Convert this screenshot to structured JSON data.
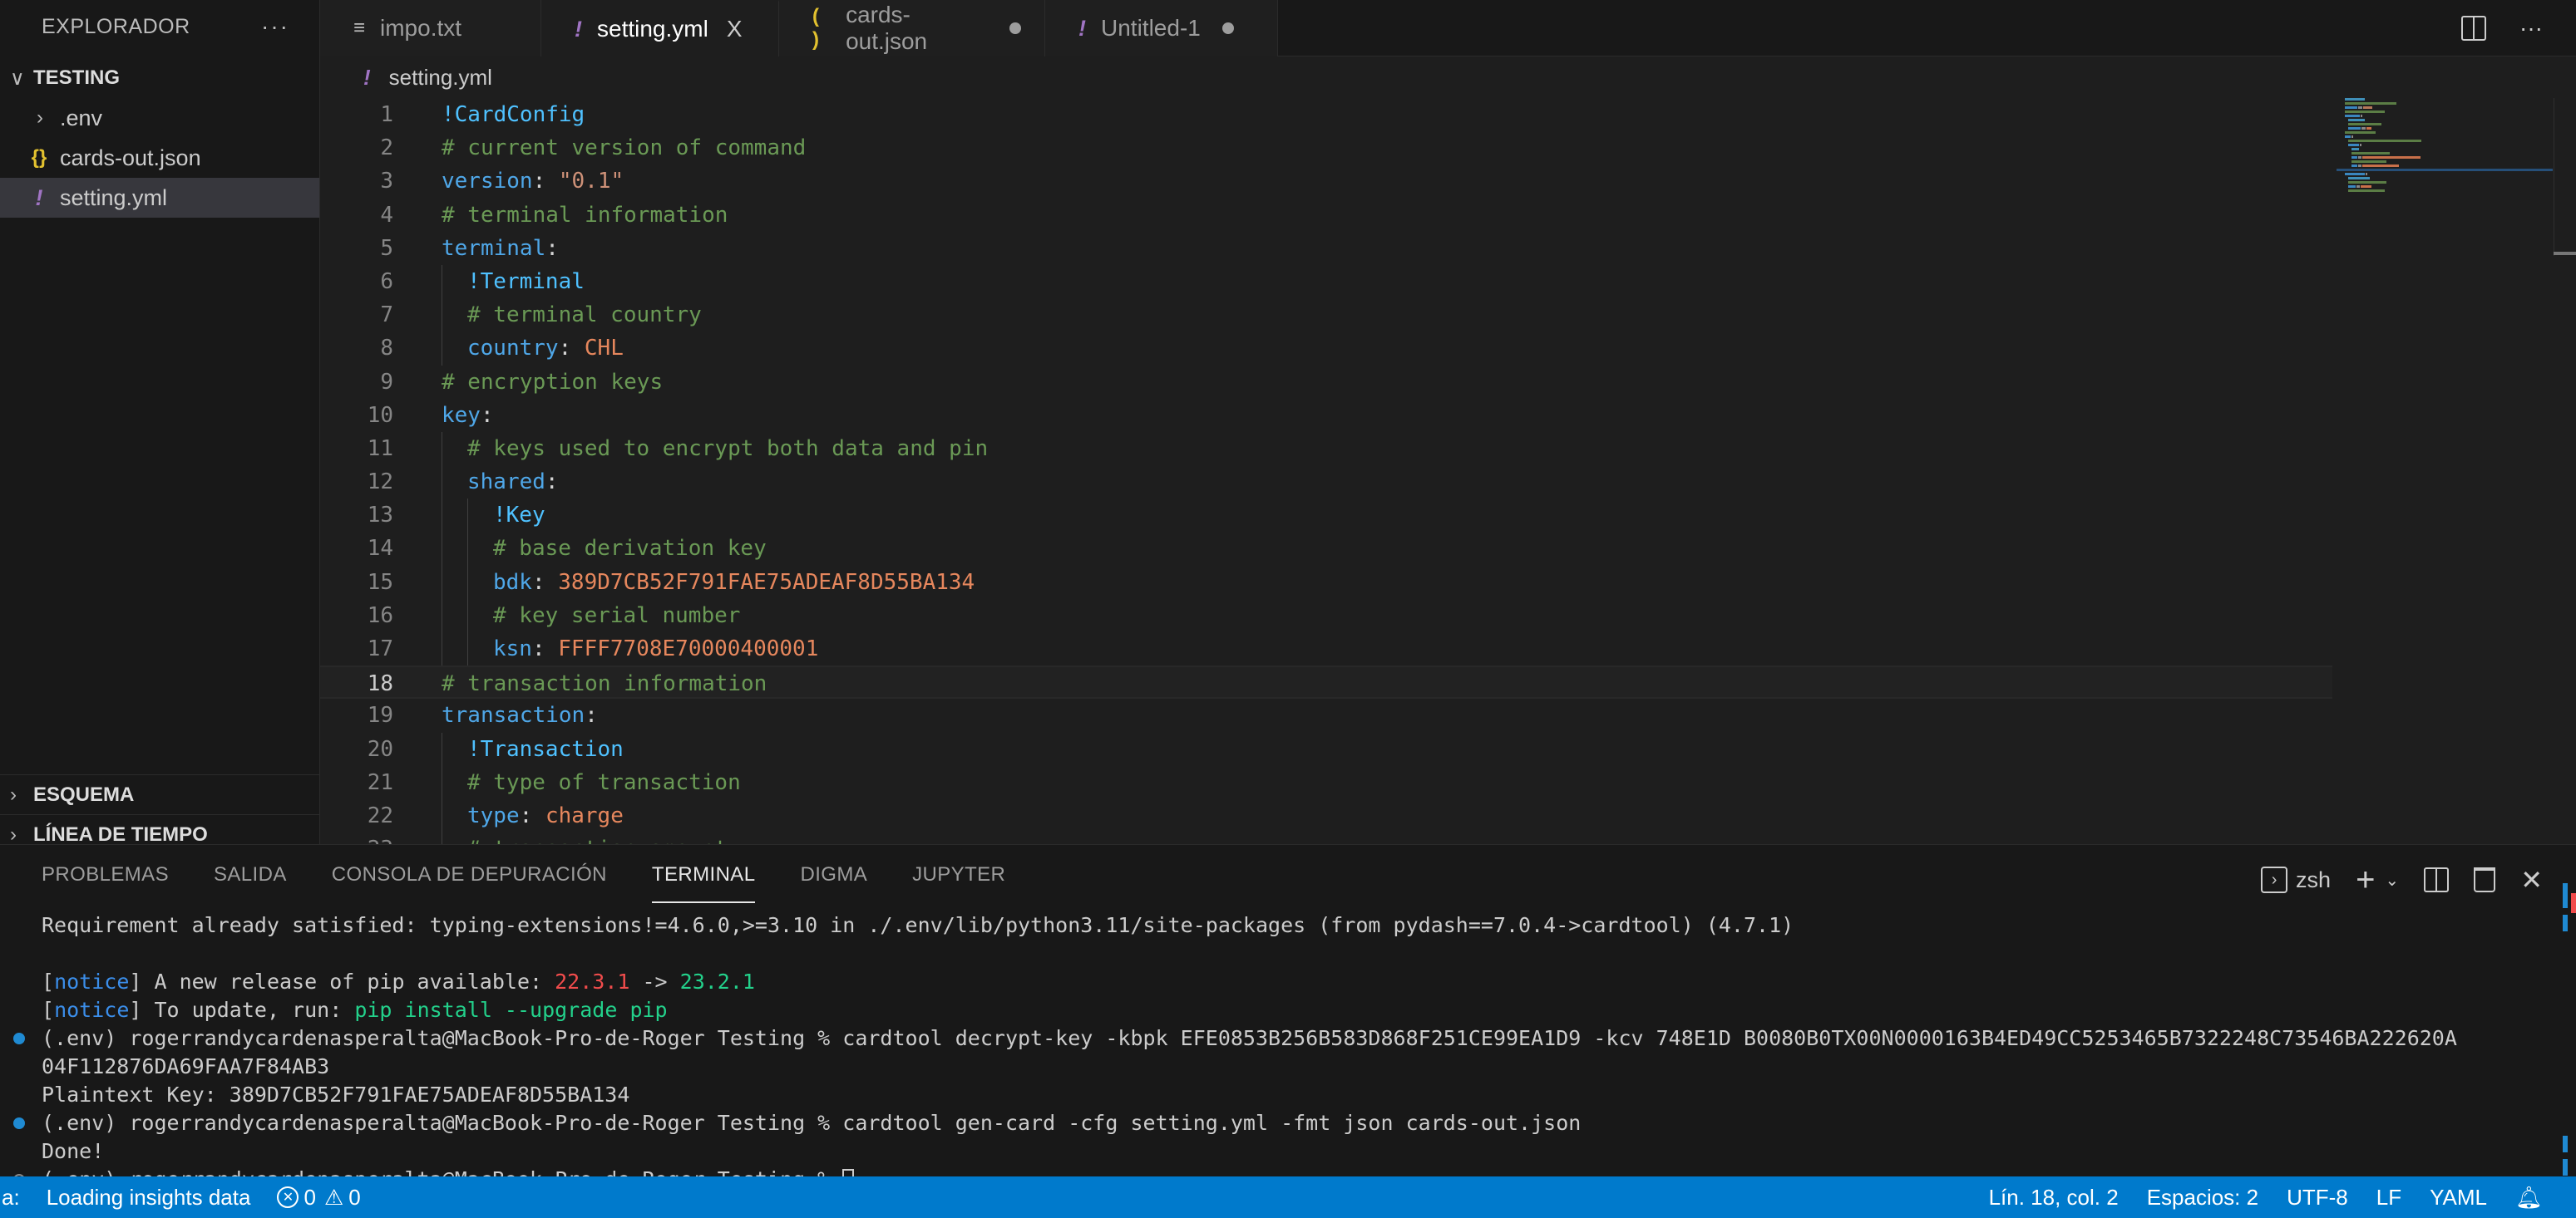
{
  "sidebar": {
    "title": "EXPLORADOR",
    "more_label": "···",
    "folder": "TESTING",
    "items": [
      {
        "label": ".env",
        "icon": "chevron-right-icon",
        "kind": "folder"
      },
      {
        "label": "cards-out.json",
        "icon": "json-file-icon",
        "kind": "json"
      },
      {
        "label": "setting.yml",
        "icon": "yaml-file-icon",
        "kind": "yml",
        "active": true
      }
    ],
    "sections": [
      "ESQUEMA",
      "LÍNEA DE TIEMPO"
    ]
  },
  "tabs": [
    {
      "label": "impo.txt",
      "icon": "text-file-icon",
      "state": "normal"
    },
    {
      "label": "setting.yml",
      "icon": "yaml-file-icon",
      "state": "active",
      "close": "X"
    },
    {
      "label": "cards-out.json",
      "icon": "json-file-icon",
      "state": "modified"
    },
    {
      "label": "Untitled-1",
      "icon": "yaml-file-icon",
      "state": "modified"
    }
  ],
  "tab_actions": {
    "split": "split-editor-icon",
    "more": "···"
  },
  "breadcrumb": {
    "file": "setting.yml"
  },
  "editor": {
    "current_line": 18,
    "lines": [
      {
        "n": "1",
        "indent": 0,
        "tokens": [
          [
            "tag",
            "!CardConfig"
          ]
        ]
      },
      {
        "n": "2",
        "indent": 0,
        "tokens": [
          [
            "cm",
            "# current version of command"
          ]
        ]
      },
      {
        "n": "3",
        "indent": 0,
        "tokens": [
          [
            "key",
            "version"
          ],
          [
            "pun",
            ": "
          ],
          [
            "str",
            "\"0.1\""
          ]
        ]
      },
      {
        "n": "4",
        "indent": 0,
        "tokens": [
          [
            "cm",
            "# terminal information"
          ]
        ]
      },
      {
        "n": "5",
        "indent": 0,
        "tokens": [
          [
            "key",
            "terminal"
          ],
          [
            "pun",
            ":"
          ]
        ]
      },
      {
        "n": "6",
        "indent": 1,
        "tokens": [
          [
            "tag",
            "!Terminal"
          ]
        ]
      },
      {
        "n": "7",
        "indent": 1,
        "tokens": [
          [
            "cm",
            "# terminal country"
          ]
        ]
      },
      {
        "n": "8",
        "indent": 1,
        "tokens": [
          [
            "key",
            "country"
          ],
          [
            "pun",
            ": "
          ],
          [
            "val",
            "CHL"
          ]
        ]
      },
      {
        "n": "9",
        "indent": 0,
        "tokens": [
          [
            "cm",
            "# encryption keys"
          ]
        ]
      },
      {
        "n": "10",
        "indent": 0,
        "tokens": [
          [
            "key",
            "key"
          ],
          [
            "pun",
            ":"
          ]
        ]
      },
      {
        "n": "11",
        "indent": 1,
        "tokens": [
          [
            "cm",
            "# keys used to encrypt both data and pin"
          ]
        ]
      },
      {
        "n": "12",
        "indent": 1,
        "tokens": [
          [
            "key",
            "shared"
          ],
          [
            "pun",
            ":"
          ]
        ]
      },
      {
        "n": "13",
        "indent": 2,
        "tokens": [
          [
            "tag",
            "!Key"
          ]
        ]
      },
      {
        "n": "14",
        "indent": 2,
        "tokens": [
          [
            "cm",
            "# base derivation key"
          ]
        ]
      },
      {
        "n": "15",
        "indent": 2,
        "tokens": [
          [
            "key",
            "bdk"
          ],
          [
            "pun",
            ": "
          ],
          [
            "val",
            "389D7CB52F791FAE75ADEAF8D55BA134"
          ]
        ]
      },
      {
        "n": "16",
        "indent": 2,
        "tokens": [
          [
            "cm",
            "# key serial number"
          ]
        ]
      },
      {
        "n": "17",
        "indent": 2,
        "tokens": [
          [
            "key",
            "ksn"
          ],
          [
            "pun",
            ": "
          ],
          [
            "val",
            "FFFF7708E70000400001"
          ]
        ]
      },
      {
        "n": "18",
        "indent": 0,
        "tokens": [
          [
            "cm",
            "# transaction information"
          ]
        ]
      },
      {
        "n": "19",
        "indent": 0,
        "tokens": [
          [
            "key",
            "transaction"
          ],
          [
            "pun",
            ":"
          ]
        ]
      },
      {
        "n": "20",
        "indent": 1,
        "tokens": [
          [
            "tag",
            "!Transaction"
          ]
        ]
      },
      {
        "n": "21",
        "indent": 1,
        "tokens": [
          [
            "cm",
            "# type of transaction"
          ]
        ]
      },
      {
        "n": "22",
        "indent": 1,
        "tokens": [
          [
            "key",
            "type"
          ],
          [
            "pun",
            ": "
          ],
          [
            "val",
            "charge"
          ]
        ]
      },
      {
        "n": "23",
        "indent": 1,
        "tokens": [
          [
            "cm",
            "# transaction amount"
          ]
        ]
      }
    ]
  },
  "panel": {
    "tabs": [
      "PROBLEMAS",
      "SALIDA",
      "CONSOLA DE DEPURACIÓN",
      "TERMINAL",
      "DIGMA",
      "JUPYTER"
    ],
    "active_tab": "TERMINAL",
    "shell": "zsh",
    "actions": {
      "new": "+",
      "dropdown": "⌄",
      "split": "split-terminal-icon",
      "kill": "trash-icon",
      "close": "✕"
    }
  },
  "terminal": {
    "lines": [
      {
        "mark": "",
        "segments": [
          [
            "",
            "Requirement already satisfied: typing-extensions!=4.6.0,>=3.10 in ./.env/lib/python3.11/site-packages (from pydash==7.0.4->cardtool) (4.7.1)"
          ]
        ]
      },
      {
        "mark": "",
        "segments": [
          [
            "",
            " "
          ]
        ]
      },
      {
        "mark": "",
        "segments": [
          [
            "",
            "["
          ],
          [
            "notice",
            "notice"
          ],
          [
            "",
            "] A new release of pip available: "
          ],
          [
            "red",
            "22.3.1"
          ],
          [
            "",
            " -> "
          ],
          [
            "green",
            "23.2.1"
          ]
        ]
      },
      {
        "mark": "",
        "segments": [
          [
            "",
            "["
          ],
          [
            "notice",
            "notice"
          ],
          [
            "",
            "] To update, run: "
          ],
          [
            "green",
            "pip install --upgrade pip"
          ]
        ]
      },
      {
        "mark": "blue",
        "segments": [
          [
            "",
            "(.env) rogerrandycardenasperalta@MacBook-Pro-de-Roger Testing % cardtool decrypt-key -kbpk EFE0853B256B583D868F251CE99EA1D9 -kcv 748E1D B0080B0TX00N0000163B4ED49CC5253465B7322248C73546BA222620A"
          ]
        ]
      },
      {
        "mark": "",
        "segments": [
          [
            "",
            "04F112876DA69FAA7F84AB3"
          ]
        ]
      },
      {
        "mark": "",
        "segments": [
          [
            "",
            "Plaintext Key: 389D7CB52F791FAE75ADEAF8D55BA134"
          ]
        ]
      },
      {
        "mark": "blue",
        "segments": [
          [
            "",
            "(.env) rogerrandycardenasperalta@MacBook-Pro-de-Roger Testing % cardtool gen-card -cfg setting.yml -fmt json cards-out.json"
          ]
        ]
      },
      {
        "mark": "",
        "segments": [
          [
            "",
            "Done!"
          ]
        ]
      },
      {
        "mark": "hollow",
        "segments": [
          [
            "",
            "(.env) rogerrandycardenasperalta@MacBook-Pro-de-Roger Testing % "
          ]
        ],
        "cursor": true
      }
    ]
  },
  "statusbar": {
    "left_prefix": "a:",
    "insights": "Loading insights data",
    "errors": "0",
    "warnings": "0",
    "position": "Lín. 18, col. 2",
    "spaces": "Espacios: 2",
    "encoding": "UTF-8",
    "eol": "LF",
    "language": "YAML"
  },
  "colors": {
    "accent": "#007acc",
    "yaml_icon": "#a074c4",
    "json_icon": "#e2c12f",
    "comment": "#6a9955",
    "key": "#4fa7e8",
    "value": "#e6875d"
  }
}
